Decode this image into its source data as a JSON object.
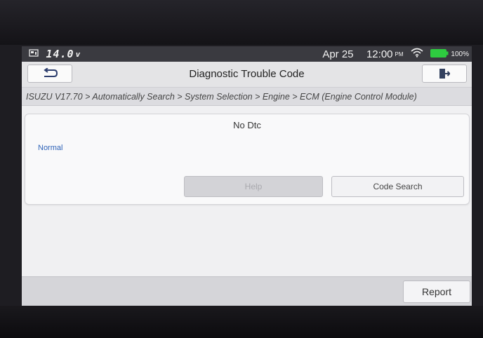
{
  "status_bar": {
    "voltage": "14.0",
    "voltage_unit": "v",
    "date": "Apr 25",
    "time": "12:00",
    "ampm": "PM",
    "battery": "100%",
    "icons": [
      "vci-connection-icon",
      "wifi-icon",
      "battery-icon"
    ],
    "battery_color": "#2ecc40"
  },
  "header": {
    "title": "Diagnostic Trouble Code",
    "back_icon": "back-arrow-icon",
    "exit_icon": "exit-icon"
  },
  "breadcrumb": "ISUZU V17.70 > Automatically Search > System Selection > Engine > ECM (Engine Control Module)",
  "dtc_panel": {
    "title": "No Dtc",
    "status": "Normal",
    "status_color": "#2f63b8",
    "help_label": "Help",
    "code_search_label": "Code Search"
  },
  "footer": {
    "report_label": "Report"
  }
}
